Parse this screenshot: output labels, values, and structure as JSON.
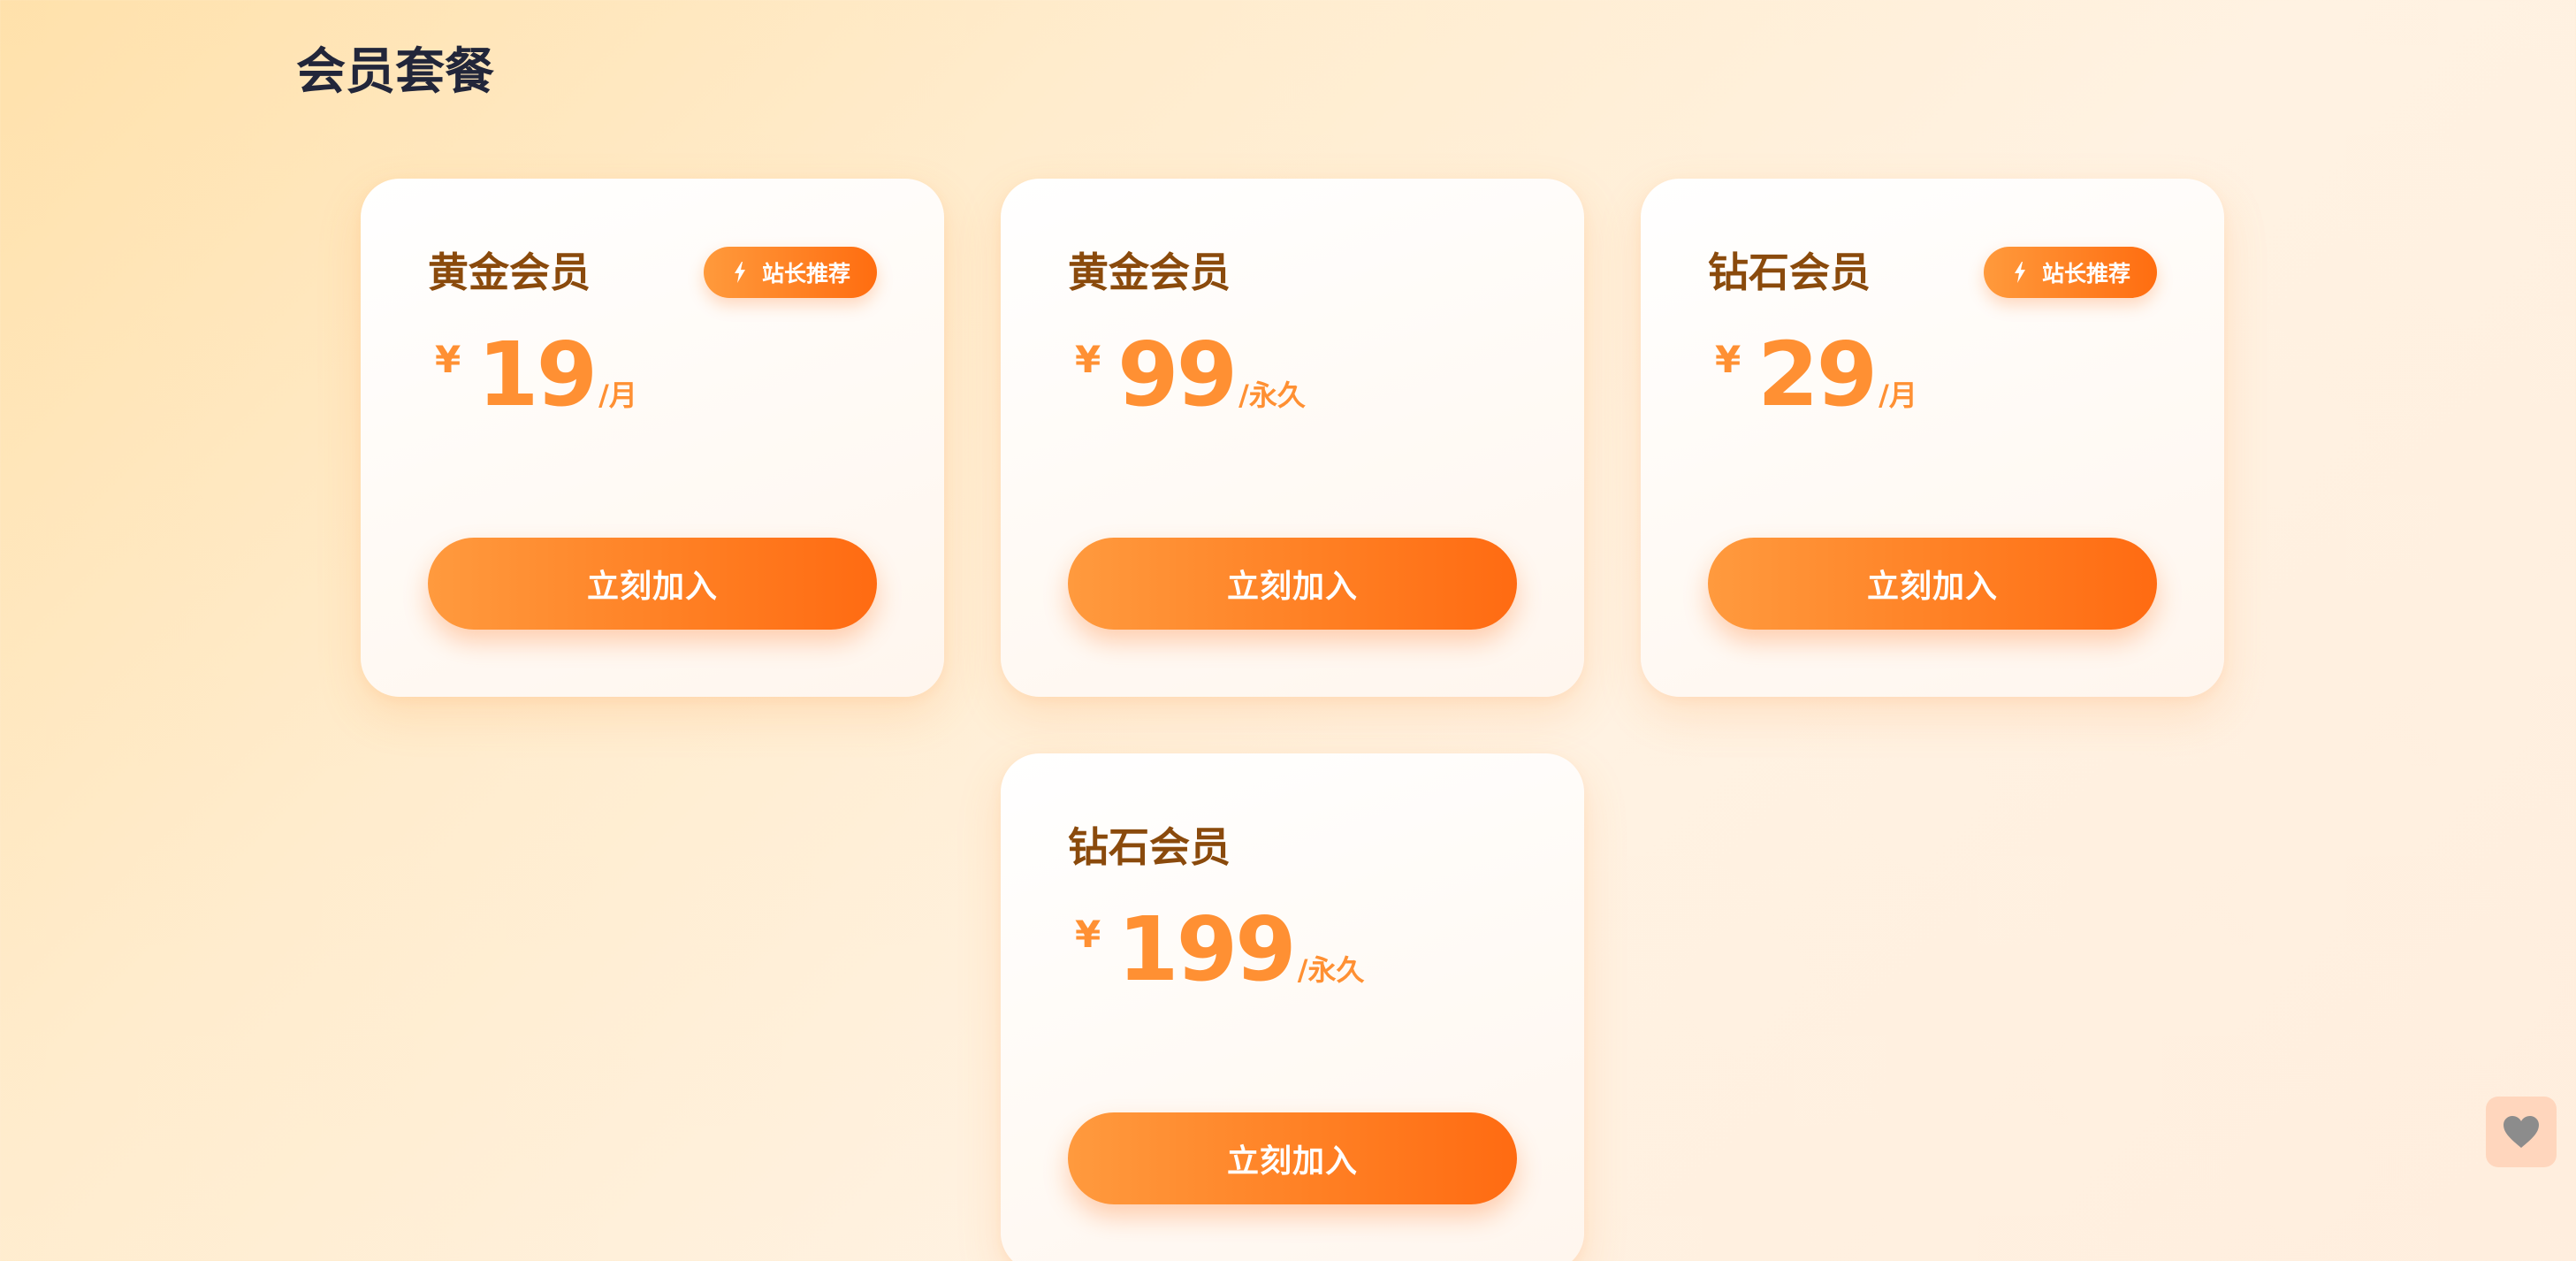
{
  "page": {
    "title": "会员套餐"
  },
  "plans": [
    {
      "name": "黄金会员",
      "badge": "站长推荐",
      "currency": "¥",
      "price": "19",
      "unit": "/月",
      "button_label": "立刻加入"
    },
    {
      "name": "黄金会员",
      "badge": "",
      "currency": "¥",
      "price": "99",
      "unit": "/永久",
      "button_label": "立刻加入"
    },
    {
      "name": "钻石会员",
      "badge": "站长推荐",
      "currency": "¥",
      "price": "29",
      "unit": "/月",
      "button_label": "立刻加入"
    },
    {
      "name": "钻石会员",
      "badge": "",
      "currency": "¥",
      "price": "199",
      "unit": "/永久",
      "button_label": "立刻加入"
    }
  ],
  "icons": {
    "badge_icon": "lightning-icon",
    "floating_button_icon": "heart-icon"
  },
  "colors": {
    "accent": "#ff7a1a",
    "price": "#ff9033",
    "plan_name": "#8a4a0c",
    "title": "#22263a",
    "floating_button_bg": "#ffd6bd",
    "floating_icon": "#8c8c8c"
  }
}
